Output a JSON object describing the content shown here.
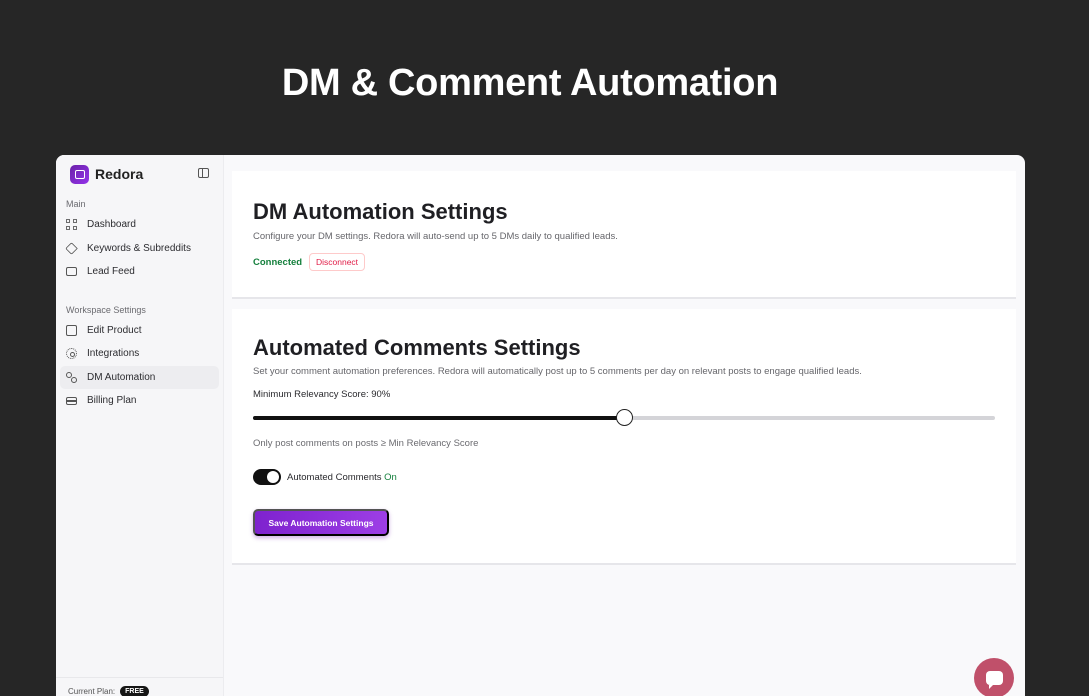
{
  "hero": {
    "title": "DM & Comment Automation"
  },
  "sidebar": {
    "brand": "Redora",
    "sections": {
      "main": "Main",
      "workspace": "Workspace Settings"
    },
    "main_items": [
      {
        "label": "Dashboard",
        "icon": "grid-icon"
      },
      {
        "label": "Keywords & Subreddits",
        "icon": "tag-icon"
      },
      {
        "label": "Lead Feed",
        "icon": "chat-icon"
      }
    ],
    "workspace_items": [
      {
        "label": "Edit Product",
        "icon": "edit-icon"
      },
      {
        "label": "Integrations",
        "icon": "gear-icon"
      },
      {
        "label": "DM Automation",
        "icon": "route-icon",
        "active": true
      },
      {
        "label": "Billing Plan",
        "icon": "credit-card-icon"
      }
    ],
    "plan": {
      "label": "Current Plan:",
      "badge": "FREE"
    }
  },
  "dm_settings": {
    "title": "DM Automation Settings",
    "description": "Configure your DM settings. Redora will auto-send up to 5 DMs daily to qualified leads.",
    "status": "Connected",
    "disconnect_label": "Disconnect"
  },
  "comment_settings": {
    "title": "Automated Comments Settings",
    "description": "Set your comment automation preferences. Redora will automatically post up to 5 comments per day on relevant posts to engage qualified leads.",
    "slider_label": "Minimum Relevancy Score: 90%",
    "slider_fraction": 0.5,
    "hint": "Only post comments on posts ≥ Min Relevancy Score",
    "toggle_label": "Automated Comments",
    "toggle_state": "On",
    "save_label": "Save Automation Settings"
  },
  "colors": {
    "accent": "#7e22ce",
    "success": "#15803d",
    "danger": "#e11d48"
  }
}
